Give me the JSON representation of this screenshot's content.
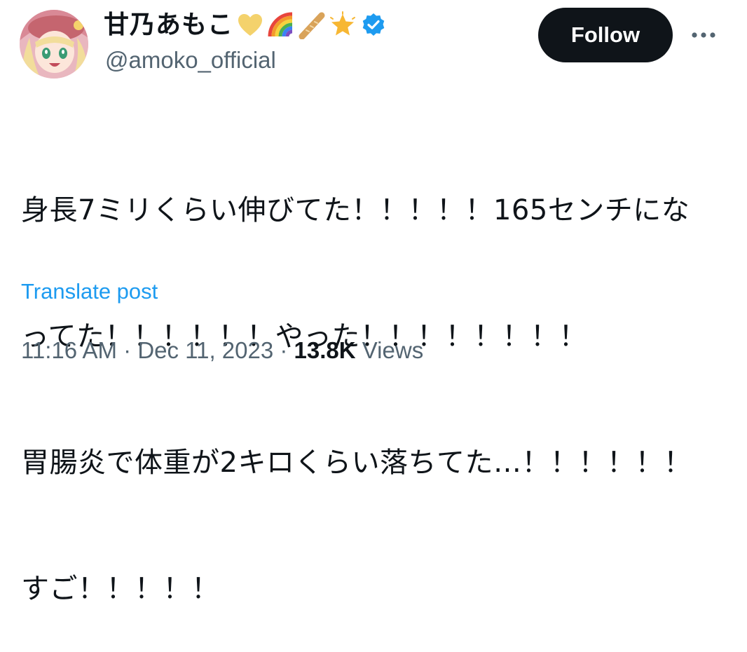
{
  "user": {
    "display_name": "甘乃あもこ",
    "handle": "@amoko_official",
    "badges": [
      "yellow-heart-icon",
      "rainbow-icon",
      "baguette-icon",
      "glowing-star-icon",
      "verified-badge-icon"
    ],
    "verified_color": "#1d9bf0"
  },
  "actions": {
    "follow_label": "Follow",
    "more_icon": "more-horizontal-icon"
  },
  "tweet": {
    "lines": [
      "身長7ミリくらい伸びてた！！！！！165センチにな",
      "ってた！！！！！！やった！！！！！！！！",
      "胃腸炎で体重が2キロくらい落ちてた…！！！！！！",
      "すご！！！！！"
    ],
    "translate_label": "Translate post"
  },
  "meta": {
    "time": "11:16 AM",
    "separator": "·",
    "date": "Dec 11, 2023",
    "views_count": "13.8K",
    "views_label": "Views"
  },
  "colors": {
    "text": "#0f1419",
    "secondary": "#536471",
    "link": "#1d9bf0",
    "button_bg": "#0f1419"
  }
}
